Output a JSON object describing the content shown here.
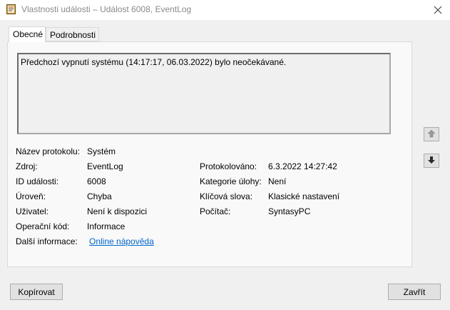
{
  "window": {
    "title": "Vlastnosti události – Událost 6008, EventLog"
  },
  "tabs": [
    {
      "label": "Obecné",
      "active": true
    },
    {
      "label": "Podrobnosti",
      "active": false
    }
  ],
  "description": "Předchozí vypnutí systému (14:17:17, 06.03.2022) bylo neočekávané.",
  "fields": {
    "log_name": {
      "label": "Název protokolu:",
      "value": "Systém"
    },
    "source": {
      "label": "Zdroj:",
      "value": "EventLog"
    },
    "logged": {
      "label": "Protokolováno:",
      "value": "6.3.2022 14:27:42"
    },
    "event_id": {
      "label": "ID události:",
      "value": "6008"
    },
    "task_category": {
      "label": "Kategorie úlohy:",
      "value": "Není"
    },
    "level": {
      "label": "Úroveň:",
      "value": "Chyba"
    },
    "keywords": {
      "label": "Klíčová slova:",
      "value": "Klasické nastavení"
    },
    "user": {
      "label": "Uživatel:",
      "value": "Není k dispozici"
    },
    "computer": {
      "label": "Počítač:",
      "value": "SyntasyPC"
    },
    "opcode": {
      "label": "Operační kód:",
      "value": "Informace"
    },
    "more_info": {
      "label": "Další informace:",
      "value": "Online nápověda"
    }
  },
  "buttons": {
    "copy": "Kopírovat",
    "close": "Zavřít"
  },
  "icons": {
    "app": "event-properties-icon",
    "close": "close-icon",
    "up": "arrow-up-icon",
    "down": "arrow-down-icon"
  }
}
